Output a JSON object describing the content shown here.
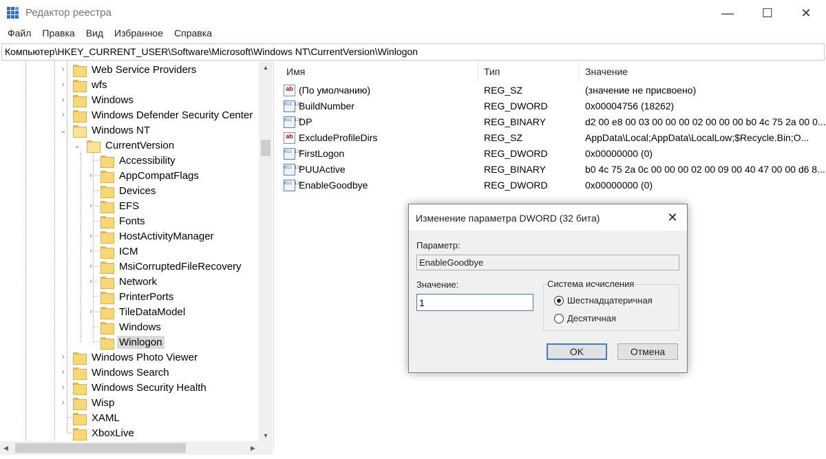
{
  "window": {
    "title": "Редактор реестра",
    "controls": {
      "minimize": "—",
      "maximize": "☐",
      "close": "✕"
    }
  },
  "menu": [
    "Файл",
    "Правка",
    "Вид",
    "Избранное",
    "Справка"
  ],
  "address": "Компьютер\\HKEY_CURRENT_USER\\Software\\Microsoft\\Windows NT\\CurrentVersion\\Winlogon",
  "tree": {
    "items": [
      {
        "label": "Web Service Providers",
        "expander": "›"
      },
      {
        "label": "wfs",
        "expander": "›"
      },
      {
        "label": "Windows",
        "expander": "›"
      },
      {
        "label": "Windows Defender Security Center",
        "expander": "›"
      },
      {
        "label": "Windows NT",
        "expander": "⌄"
      },
      {
        "label": "CurrentVersion",
        "expander": "⌄"
      },
      {
        "label": "Accessibility",
        "expander": ""
      },
      {
        "label": "AppCompatFlags",
        "expander": "›"
      },
      {
        "label": "Devices",
        "expander": ""
      },
      {
        "label": "EFS",
        "expander": "›"
      },
      {
        "label": "Fonts",
        "expander": ""
      },
      {
        "label": "HostActivityManager",
        "expander": "›"
      },
      {
        "label": "ICM",
        "expander": "›"
      },
      {
        "label": "MsiCorruptedFileRecovery",
        "expander": "›"
      },
      {
        "label": "Network",
        "expander": "›"
      },
      {
        "label": "PrinterPorts",
        "expander": ""
      },
      {
        "label": "TileDataModel",
        "expander": "›"
      },
      {
        "label": "Windows",
        "expander": ""
      },
      {
        "label": "Winlogon",
        "expander": ""
      },
      {
        "label": "Windows Photo Viewer",
        "expander": "›"
      },
      {
        "label": "Windows Search",
        "expander": "›"
      },
      {
        "label": "Windows Security Health",
        "expander": "›"
      },
      {
        "label": "Wisp",
        "expander": "›"
      },
      {
        "label": "XAML",
        "expander": ""
      },
      {
        "label": "XboxLive",
        "expander": ""
      }
    ],
    "scroll_glyphs": {
      "up": "▲",
      "down": "▼",
      "left": "◀",
      "right": "▶"
    }
  },
  "values": {
    "headers": {
      "name": "Имя",
      "type": "Тип",
      "data": "Значение"
    },
    "rows": [
      {
        "name": "(По умолчанию)",
        "type": "REG_SZ",
        "data": "(значение не присвоено)",
        "icon": "ab"
      },
      {
        "name": "BuildNumber",
        "type": "REG_DWORD",
        "data": "0x00004756 (18262)",
        "icon": "011\n110"
      },
      {
        "name": "DP",
        "type": "REG_BINARY",
        "data": "d2 00 e8 00 03 00 00 00 02 00 00 00 b0 4c 75 2a 00 0...",
        "icon": "011\n110"
      },
      {
        "name": "ExcludeProfileDirs",
        "type": "REG_SZ",
        "data": "AppData\\Local;AppData\\LocalLow;$Recycle.Bin;O...",
        "icon": "ab"
      },
      {
        "name": "FirstLogon",
        "type": "REG_DWORD",
        "data": "0x00000000 (0)",
        "icon": "011\n110"
      },
      {
        "name": "PUUActive",
        "type": "REG_BINARY",
        "data": "b0 4c 75 2a 0c 00 00 00 02 00 09 00 40 47 00 00 d6 8...",
        "icon": "011\n110"
      },
      {
        "name": "EnableGoodbye",
        "type": "REG_DWORD",
        "data": "0x00000000 (0)",
        "icon": "011\n110"
      }
    ]
  },
  "dialog": {
    "title": "Изменение параметра DWORD (32 бита)",
    "close": "✕",
    "param_label": "Параметр:",
    "param_value": "EnableGoodbye",
    "value_label": "Значение:",
    "value": "1",
    "base_group": "Система исчисления",
    "radio_hex": "Шестнадцатеричная",
    "radio_dec": "Десятичная",
    "ok": "OK",
    "cancel": "Отмена"
  }
}
